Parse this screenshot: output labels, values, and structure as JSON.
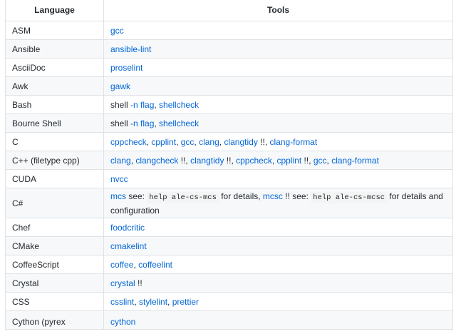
{
  "table": {
    "headers": {
      "language": "Language",
      "tools": "Tools"
    },
    "rows": [
      {
        "language": "ASM",
        "tools": [
          {
            "t": "gcc",
            "link": true
          }
        ]
      },
      {
        "language": "Ansible",
        "tools": [
          {
            "t": "ansible-lint",
            "link": true
          }
        ]
      },
      {
        "language": "AsciiDoc",
        "tools": [
          {
            "t": "proselint",
            "link": true
          }
        ]
      },
      {
        "language": "Awk",
        "tools": [
          {
            "t": "gawk",
            "link": true
          }
        ]
      },
      {
        "language": "Bash",
        "tools": [
          {
            "t": "shell "
          },
          {
            "t": "-n flag",
            "link": true
          },
          {
            "t": ", "
          },
          {
            "t": "shellcheck",
            "link": true
          }
        ]
      },
      {
        "language": "Bourne Shell",
        "tools": [
          {
            "t": "shell "
          },
          {
            "t": "-n flag",
            "link": true
          },
          {
            "t": ", "
          },
          {
            "t": "shellcheck",
            "link": true
          }
        ]
      },
      {
        "language": "C",
        "tools": [
          {
            "t": "cppcheck",
            "link": true
          },
          {
            "t": ", "
          },
          {
            "t": "cpplint",
            "link": true
          },
          {
            "t": ", "
          },
          {
            "t": "gcc",
            "link": true
          },
          {
            "t": ", "
          },
          {
            "t": "clang",
            "link": true
          },
          {
            "t": ", "
          },
          {
            "t": "clangtidy",
            "link": true
          },
          {
            "t": " !!, "
          },
          {
            "t": "clang-format",
            "link": true
          }
        ]
      },
      {
        "language": "C++ (filetype cpp)",
        "tools": [
          {
            "t": "clang",
            "link": true
          },
          {
            "t": ", "
          },
          {
            "t": "clangcheck",
            "link": true
          },
          {
            "t": " !!, "
          },
          {
            "t": "clangtidy",
            "link": true
          },
          {
            "t": " !!, "
          },
          {
            "t": "cppcheck",
            "link": true
          },
          {
            "t": ", "
          },
          {
            "t": "cpplint",
            "link": true
          },
          {
            "t": " !!, "
          },
          {
            "t": "gcc",
            "link": true
          },
          {
            "t": ", "
          },
          {
            "t": "clang-format",
            "link": true
          }
        ]
      },
      {
        "language": "CUDA",
        "tools": [
          {
            "t": "nvcc",
            "link": true
          }
        ]
      },
      {
        "language": "C#",
        "tall": true,
        "tools": [
          {
            "t": "mcs",
            "link": true
          },
          {
            "t": " see: "
          },
          {
            "t": "help ale-cs-mcs",
            "code": true
          },
          {
            "t": " for details, "
          },
          {
            "t": "mcsc",
            "link": true
          },
          {
            "t": " !! see: "
          },
          {
            "t": "help ale-cs-mcsc",
            "code": true
          },
          {
            "t": " for details and configuration"
          }
        ]
      },
      {
        "language": "Chef",
        "tools": [
          {
            "t": "foodcritic",
            "link": true
          }
        ]
      },
      {
        "language": "CMake",
        "tools": [
          {
            "t": "cmakelint",
            "link": true
          }
        ]
      },
      {
        "language": "CoffeeScript",
        "tools": [
          {
            "t": "coffee",
            "link": true
          },
          {
            "t": ", "
          },
          {
            "t": "coffeelint",
            "link": true
          }
        ]
      },
      {
        "language": "Crystal",
        "tools": [
          {
            "t": "crystal",
            "link": true
          },
          {
            "t": " !!"
          }
        ]
      },
      {
        "language": "CSS",
        "tools": [
          {
            "t": "csslint",
            "link": true
          },
          {
            "t": ", "
          },
          {
            "t": "stylelint",
            "link": true
          },
          {
            "t": ", "
          },
          {
            "t": "prettier",
            "link": true
          }
        ]
      },
      {
        "language": "Cython (pyrex",
        "cut": true,
        "tools": [
          {
            "t": "cython",
            "link": true
          }
        ]
      }
    ]
  }
}
